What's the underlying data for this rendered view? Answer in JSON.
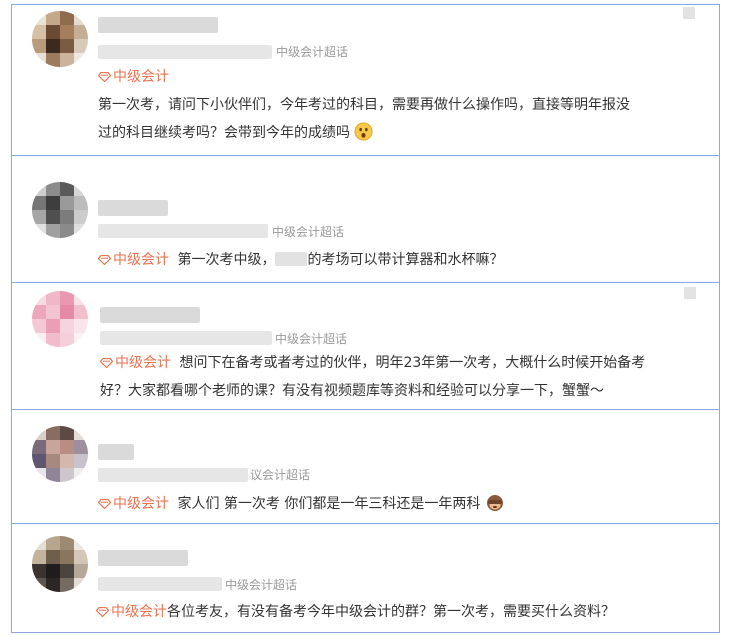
{
  "posts": [
    {
      "source": "中级会计超话",
      "topic": "中级会计",
      "lines": [
        "第一次考，请问下小伙伴们，今年考过的科目，需要再做什么操作吗，直接等明年报没",
        "过的科目继续考吗？会带到今年的成绩吗"
      ],
      "emoji": "surprised-face-emoji"
    },
    {
      "source": "中级会计超话",
      "topic": "中级会计",
      "text_a": "第一次考中级，",
      "text_b": "的考场可以带计算器和水杯嘛？"
    },
    {
      "source": "中级会计超话",
      "topic": "中级会计",
      "lines": [
        "想问下在备考或者考过的伙伴，明年23年第一次考，大概什么时候开始备考",
        "好？大家都看哪个老师的课？有没有视频题库等资料和经验可以分享一下，蟹蟹～"
      ]
    },
    {
      "source": "议会计超话",
      "topic": "中级会计",
      "text": "家人们 第一次考 你们都是一年三科还是一年两科",
      "emoji": "monkey-covering-eyes-emoji"
    },
    {
      "source": "中级会计超话",
      "topic": "中级会计",
      "text": "各位考友，有没有备考今年中级会计的群？第一次考，需要买什么资料？"
    }
  ],
  "colors": {
    "topic": "#eb7350",
    "border": "#8aa8e4",
    "text": "#333333",
    "muted": "#9a9a9a"
  },
  "icons": {
    "topic": "topic-diamond-icon"
  }
}
